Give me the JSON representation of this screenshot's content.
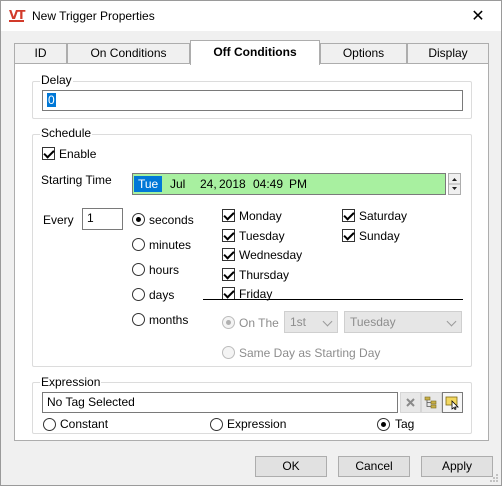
{
  "window": {
    "title": "New Trigger Properties",
    "logo": "VT",
    "close_glyph": "✕"
  },
  "tabs": [
    {
      "label": "ID",
      "active": false
    },
    {
      "label": "On Conditions",
      "active": false
    },
    {
      "label": "Off Conditions",
      "active": true
    },
    {
      "label": "Options",
      "active": false
    },
    {
      "label": "Display",
      "active": false
    }
  ],
  "delay": {
    "label": "Delay",
    "value": "0"
  },
  "schedule": {
    "label": "Schedule",
    "enable_label": "Enable",
    "enable_checked": true,
    "starting_time_label": "Starting Time",
    "datetime": {
      "weekday": "Tue",
      "month": "Jul",
      "day": "24,",
      "year": "2018",
      "time": "04:49",
      "ampm": "PM"
    },
    "every_label": "Every",
    "every_value": "1",
    "units": [
      {
        "label": "seconds",
        "checked": true
      },
      {
        "label": "minutes",
        "checked": false
      },
      {
        "label": "hours",
        "checked": false
      },
      {
        "label": "days",
        "checked": false
      },
      {
        "label": "months",
        "checked": false
      }
    ],
    "days_left": [
      {
        "label": "Monday",
        "checked": true
      },
      {
        "label": "Tuesday",
        "checked": true
      },
      {
        "label": "Wednesday",
        "checked": true
      },
      {
        "label": "Thursday",
        "checked": true
      },
      {
        "label": "Friday",
        "checked": true
      }
    ],
    "days_right": [
      {
        "label": "Saturday",
        "checked": true
      },
      {
        "label": "Sunday",
        "checked": true
      }
    ],
    "on_the_label": "On The",
    "ordinal_value": "1st",
    "weekday_value": "Tuesday",
    "same_day_label": "Same Day as Starting Day"
  },
  "expression": {
    "label": "Expression",
    "value": "No Tag Selected",
    "modes": [
      {
        "label": "Constant",
        "checked": false
      },
      {
        "label": "Expression",
        "checked": false
      },
      {
        "label": "Tag",
        "checked": true
      }
    ]
  },
  "buttons": {
    "ok": "OK",
    "cancel": "Cancel",
    "apply": "Apply"
  },
  "colors": {
    "datetime_bg": "#a8f0a0",
    "selection": "#0078d7",
    "accent_logo": "#d23a2a"
  }
}
